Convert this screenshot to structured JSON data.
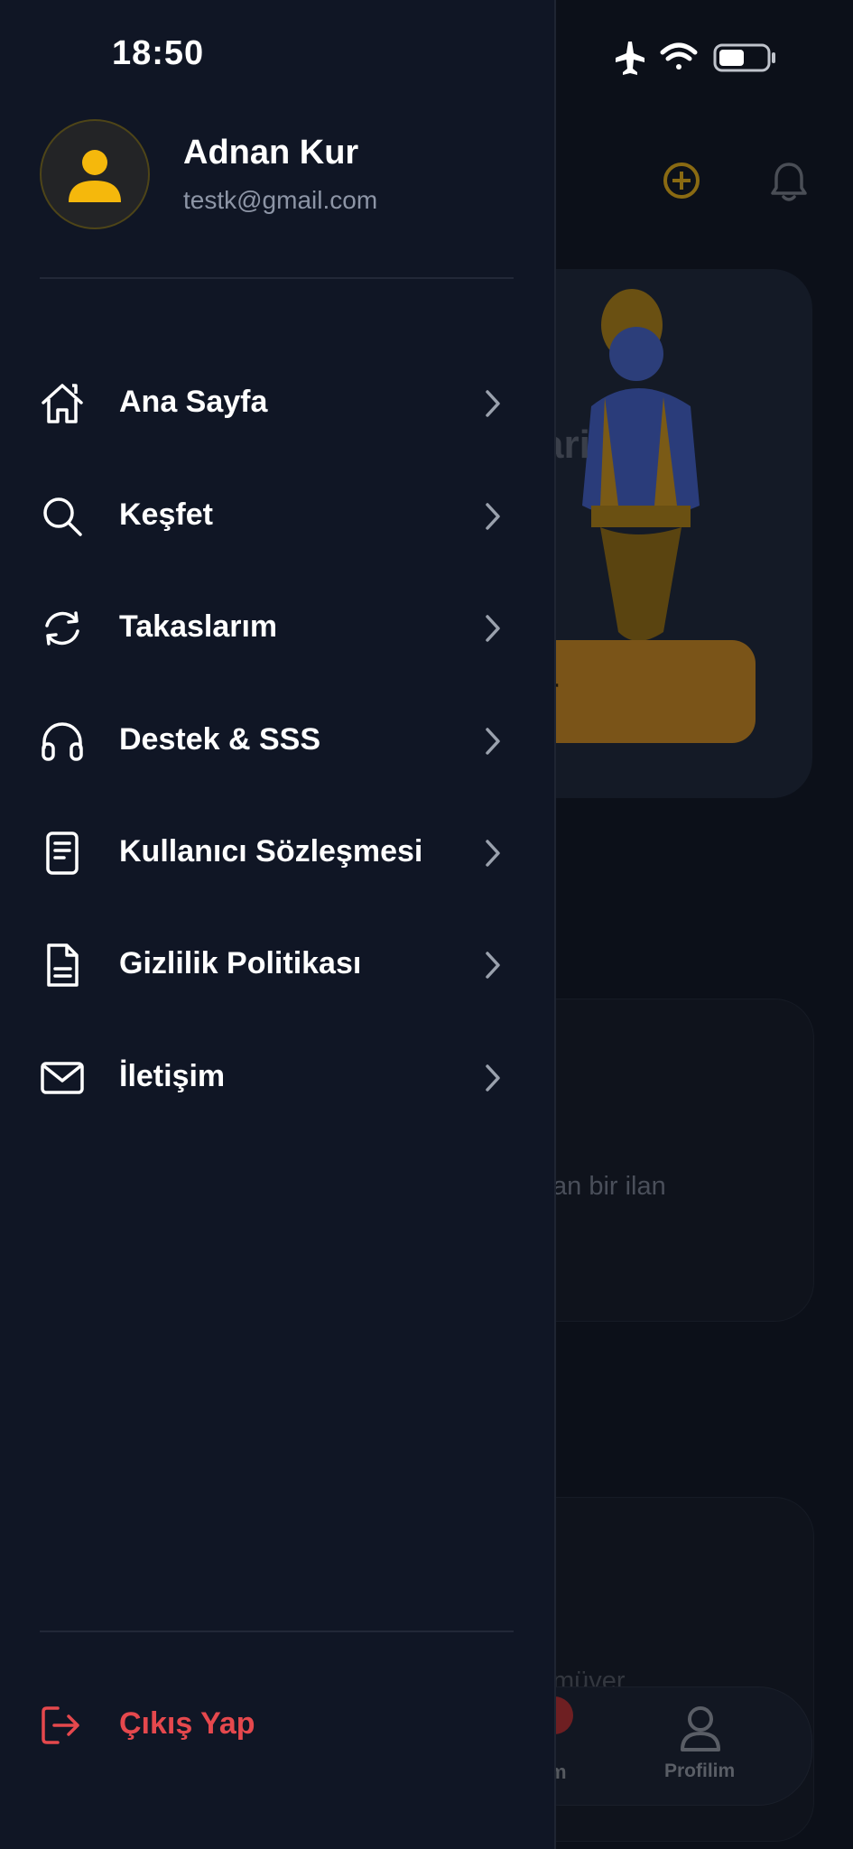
{
  "status_bar": {
    "time": "18:50",
    "icons": [
      "airplane-icon",
      "wifi-icon",
      "battery-icon"
    ]
  },
  "drawer": {
    "user": {
      "name": "Adnan Kur",
      "email": "testk@gmail.com",
      "avatar_icon": "user-icon"
    },
    "menu": [
      {
        "label": "Ana Sayfa",
        "icon": "home-icon"
      },
      {
        "label": "Keşfet",
        "icon": "search-icon"
      },
      {
        "label": "Takaslarım",
        "icon": "swap-icon"
      },
      {
        "label": "Destek & SSS",
        "icon": "headphones-icon"
      },
      {
        "label": "Kullanıcı Sözleşmesi",
        "icon": "document-icon"
      },
      {
        "label": "Gizlilik Politikası",
        "icon": "file-icon"
      },
      {
        "label": "İletişim",
        "icon": "mail-icon"
      }
    ],
    "logout": {
      "label": "Çıkış Yap",
      "icon": "logout-icon"
    }
  },
  "background": {
    "card1_text": "ari",
    "cta_fragment": "r",
    "card2_text": "an bir ilan",
    "card3_text": "müver",
    "tabbar": {
      "partial_label": "m",
      "profile_label": "Profilim"
    }
  },
  "colors": {
    "drawer_bg": "#101625",
    "accent_gold": "#f5b80c",
    "logout_red": "#e5484d",
    "secondary_text": "#8d95a6"
  }
}
